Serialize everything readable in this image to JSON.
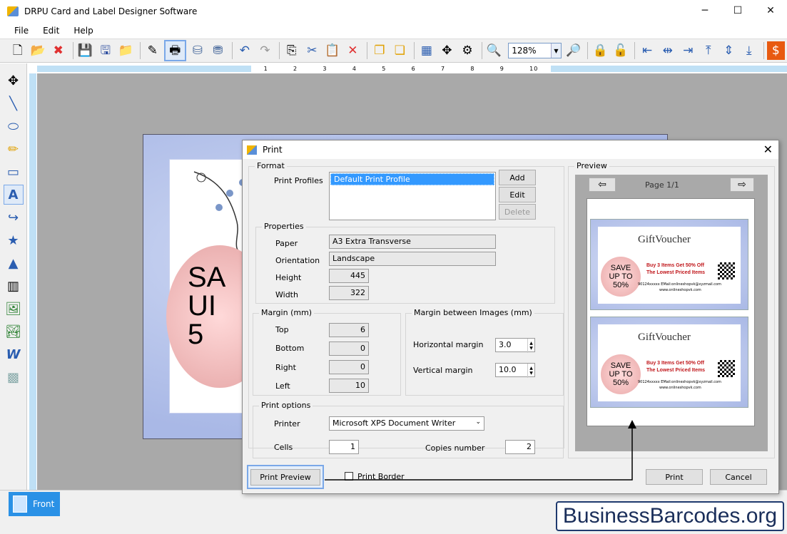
{
  "window": {
    "title": "DRPU Card and Label Designer Software",
    "minimize": "─",
    "maximize": "☐",
    "close": "✕"
  },
  "menu": [
    "File",
    "Edit",
    "Help"
  ],
  "toolbar": {
    "zoom": "128%"
  },
  "ruler": {
    "marks": [
      "1",
      "2",
      "3",
      "4",
      "5",
      "6",
      "7",
      "8",
      "9",
      "10"
    ]
  },
  "canvas": {
    "sale_text": "SA\nUI\n5"
  },
  "tabs": {
    "front": "Front"
  },
  "watermark": "BusinessBarcodes.org",
  "dialog": {
    "title": "Print",
    "close": "✕",
    "format": {
      "legend": "Format",
      "profiles_label": "Print Profiles",
      "profiles": [
        "Default Print Profile"
      ],
      "add": "Add",
      "edit": "Edit",
      "delete": "Delete"
    },
    "properties": {
      "legend": "Properties",
      "paper_label": "Paper",
      "paper": "A3 Extra Transverse",
      "orientation_label": "Orientation",
      "orientation": "Landscape",
      "height_label": "Height",
      "height": "445",
      "width_label": "Width",
      "width": "322"
    },
    "margin": {
      "legend": "Margin (mm)",
      "top_label": "Top",
      "top": "6",
      "bottom_label": "Bottom",
      "bottom": "0",
      "right_label": "Right",
      "right": "0",
      "left_label": "Left",
      "left": "10"
    },
    "margin_images": {
      "legend": "Margin between Images (mm)",
      "horizontal_label": "Horizontal margin",
      "horizontal": "3.0",
      "vertical_label": "Vertical margin",
      "vertical": "10.0"
    },
    "print_options": {
      "legend": "Print options",
      "printer_label": "Printer",
      "printer": "Microsoft XPS Document Writer",
      "cells_label": "Cells",
      "cells": "1",
      "copies_label": "Copies number",
      "copies": "2"
    },
    "preview": {
      "legend": "Preview",
      "page": "Page 1/1",
      "voucher": {
        "title": "GiftVoucher",
        "sale": "SAVE\nUP TO\n50%",
        "offer1": "Buy 3 Items Get 50% Off",
        "offer2": "The Lowest Priced Items",
        "footer": "90124xxxxx    EMail:onlineshopvk@xyzmail.com",
        "website": "www.onlineshopvk.com"
      }
    },
    "print_preview": "Print Preview",
    "print_border": "Print Border",
    "print": "Print",
    "cancel": "Cancel"
  }
}
